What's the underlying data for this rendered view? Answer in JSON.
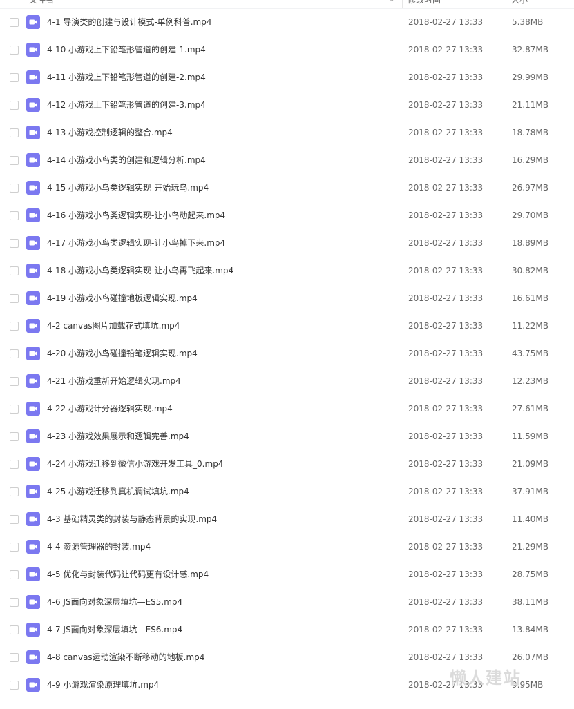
{
  "header": {
    "name_label": "文件名",
    "date_label": "修改时间",
    "size_label": "大小"
  },
  "colors": {
    "video_icon": "#7b78f0",
    "row_border": "#ffffff",
    "text_primary": "#333333",
    "text_secondary": "#666666"
  },
  "watermark": {
    "text": "懒人建站"
  },
  "files": [
    {
      "name": "4-1 导演类的创建与设计模式-单例科普.mp4",
      "date": "2018-02-27 13:33",
      "size": "5.38MB",
      "icon": "video-icon"
    },
    {
      "name": "4-10 小游戏上下铅笔形管道的创建-1.mp4",
      "date": "2018-02-27 13:33",
      "size": "32.87MB",
      "icon": "video-icon"
    },
    {
      "name": "4-11 小游戏上下铅笔形管道的创建-2.mp4",
      "date": "2018-02-27 13:33",
      "size": "29.99MB",
      "icon": "video-icon"
    },
    {
      "name": "4-12 小游戏上下铅笔形管道的创建-3.mp4",
      "date": "2018-02-27 13:33",
      "size": "21.11MB",
      "icon": "video-icon"
    },
    {
      "name": "4-13 小游戏控制逻辑的整合.mp4",
      "date": "2018-02-27 13:33",
      "size": "18.78MB",
      "icon": "video-icon"
    },
    {
      "name": "4-14 小游戏小鸟类的创建和逻辑分析.mp4",
      "date": "2018-02-27 13:33",
      "size": "16.29MB",
      "icon": "video-icon"
    },
    {
      "name": "4-15 小游戏小鸟类逻辑实现-开始玩鸟.mp4",
      "date": "2018-02-27 13:33",
      "size": "26.97MB",
      "icon": "video-icon"
    },
    {
      "name": "4-16 小游戏小鸟类逻辑实现-让小鸟动起来.mp4",
      "date": "2018-02-27 13:33",
      "size": "29.70MB",
      "icon": "video-icon"
    },
    {
      "name": "4-17 小游戏小鸟类逻辑实现-让小鸟掉下来.mp4",
      "date": "2018-02-27 13:33",
      "size": "18.89MB",
      "icon": "video-icon"
    },
    {
      "name": "4-18 小游戏小鸟类逻辑实现-让小鸟再飞起来.mp4",
      "date": "2018-02-27 13:33",
      "size": "30.82MB",
      "icon": "video-icon"
    },
    {
      "name": "4-19 小游戏小鸟碰撞地板逻辑实现.mp4",
      "date": "2018-02-27 13:33",
      "size": "16.61MB",
      "icon": "video-icon"
    },
    {
      "name": "4-2 canvas图片加载花式填坑.mp4",
      "date": "2018-02-27 13:33",
      "size": "11.22MB",
      "icon": "video-icon"
    },
    {
      "name": "4-20 小游戏小鸟碰撞铅笔逻辑实现.mp4",
      "date": "2018-02-27 13:33",
      "size": "43.75MB",
      "icon": "video-icon"
    },
    {
      "name": "4-21 小游戏重新开始逻辑实现.mp4",
      "date": "2018-02-27 13:33",
      "size": "12.23MB",
      "icon": "video-icon"
    },
    {
      "name": "4-22 小游戏计分器逻辑实现.mp4",
      "date": "2018-02-27 13:33",
      "size": "27.61MB",
      "icon": "video-icon"
    },
    {
      "name": "4-23 小游戏效果展示和逻辑完善.mp4",
      "date": "2018-02-27 13:33",
      "size": "11.59MB",
      "icon": "video-icon"
    },
    {
      "name": "4-24 小游戏迁移到微信小游戏开发工具_0.mp4",
      "date": "2018-02-27 13:33",
      "size": "21.09MB",
      "icon": "video-icon"
    },
    {
      "name": "4-25 小游戏迁移到真机调试填坑.mp4",
      "date": "2018-02-27 13:33",
      "size": "37.91MB",
      "icon": "video-icon"
    },
    {
      "name": "4-3 基础精灵类的封装与静态背景的实现.mp4",
      "date": "2018-02-27 13:33",
      "size": "11.40MB",
      "icon": "video-icon"
    },
    {
      "name": "4-4 资源管理器的封装.mp4",
      "date": "2018-02-27 13:33",
      "size": "21.29MB",
      "icon": "video-icon"
    },
    {
      "name": "4-5 优化与封装代码让代码更有设计感.mp4",
      "date": "2018-02-27 13:33",
      "size": "28.75MB",
      "icon": "video-icon"
    },
    {
      "name": "4-6 JS面向对象深层填坑—ES5.mp4",
      "date": "2018-02-27 13:33",
      "size": "38.11MB",
      "icon": "video-icon"
    },
    {
      "name": "4-7 JS面向对象深层填坑—ES6.mp4",
      "date": "2018-02-27 13:33",
      "size": "13.84MB",
      "icon": "video-icon"
    },
    {
      "name": "4-8 canvas运动渲染不断移动的地板.mp4",
      "date": "2018-02-27 13:33",
      "size": "26.07MB",
      "icon": "video-icon"
    },
    {
      "name": "4-9 小游戏渲染原理填坑.mp4",
      "date": "2018-02-27 13:33",
      "size": "9.95MB",
      "icon": "video-icon"
    }
  ]
}
